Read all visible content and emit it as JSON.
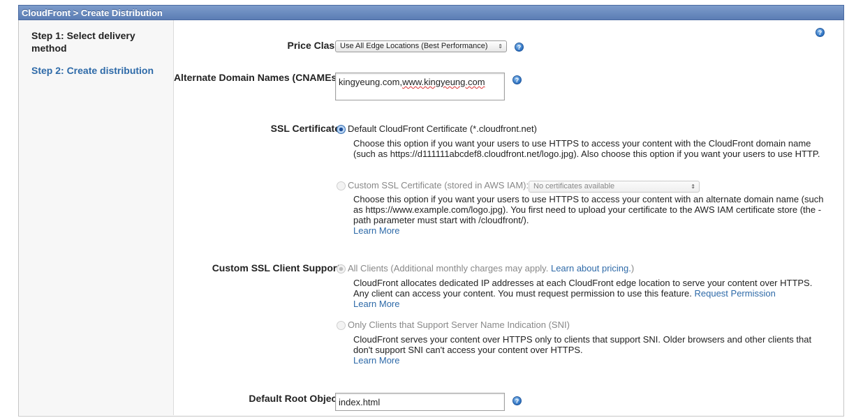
{
  "header": {
    "title": "CloudFront > Create Distribution"
  },
  "sidebar": {
    "steps": [
      {
        "label": "Step 1: Select delivery method"
      },
      {
        "label": "Step 2: Create distribution"
      }
    ]
  },
  "form": {
    "price_class": {
      "label": "Price Class",
      "value": "Use All Edge Locations (Best Performance)"
    },
    "cnames": {
      "label": "Alternate Domain Names (CNAMEs)",
      "value_prefix": "kingyeung.com,",
      "value_misspelled": "www.kingyeung.com"
    },
    "ssl_certificate": {
      "label": "SSL Certificate",
      "default_option": "Default CloudFront Certificate (*.cloudfront.net)",
      "default_desc": "Choose this option if you want your users to use HTTPS to access your content with the CloudFront domain name (such as https://d111111abcdef8.cloudfront.net/logo.jpg). Also choose this option if you want your users to use HTTP.",
      "custom_option": "Custom SSL Certificate (stored in AWS IAM):",
      "custom_select": "No certificates available",
      "custom_desc": "Choose this option if you want your users to use HTTPS to access your content with an alternate domain name (such as https://www.example.com/logo.jpg). You first need to upload your certificate to the AWS IAM certificate store (the -path parameter must start with /cloudfront/).",
      "learn_more": "Learn More"
    },
    "client_support": {
      "label": "Custom SSL Client Support",
      "all_option": "All Clients (Additional monthly charges may apply.",
      "all_pricing_link": "Learn about pricing.",
      "all_option_close": ")",
      "all_desc": "CloudFront allocates dedicated IP addresses at each CloudFront edge location to serve your content over HTTPS. Any client can access your content. You must request permission to use this feature.",
      "request_permission": "Request Permission",
      "all_learn_more": "Learn More",
      "sni_option": "Only Clients that Support Server Name Indication (SNI)",
      "sni_desc": "CloudFront serves your content over HTTPS only to clients that support SNI. Older browsers and other clients that don't support SNI can't access your content over HTTPS.",
      "sni_learn_more": "Learn More"
    },
    "root_object": {
      "label": "Default Root Object",
      "value": "index.html"
    }
  },
  "help_icon_glyph": "?"
}
